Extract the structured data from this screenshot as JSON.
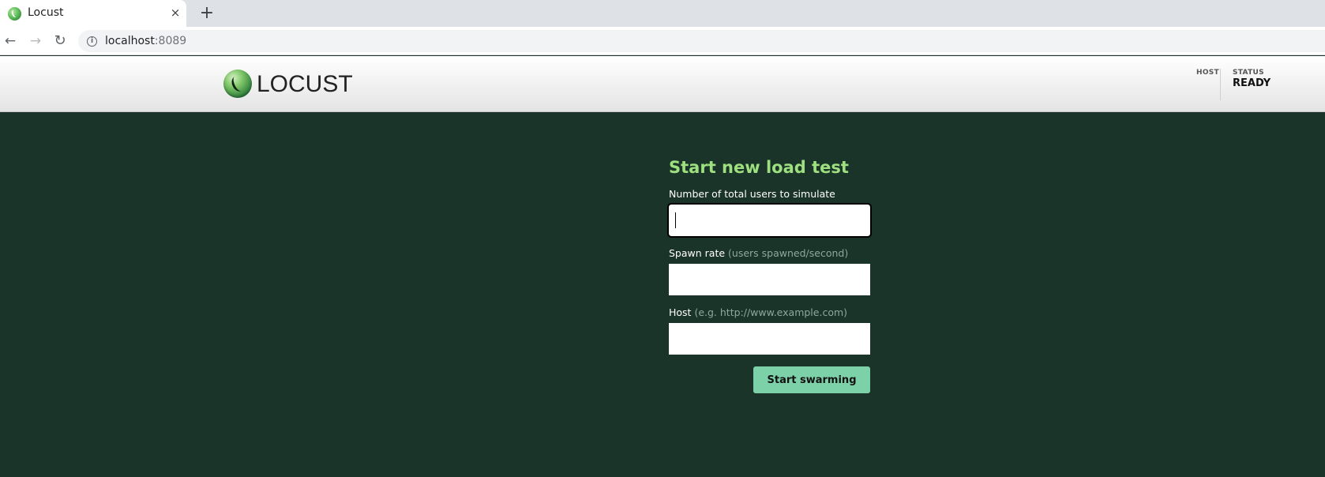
{
  "browser": {
    "tab_title": "Locust",
    "tab_close": "×",
    "new_tab": "+",
    "url_host": "localhost",
    "url_port": ":8089",
    "back_icon": "←",
    "forward_icon": "→",
    "reload_icon": "↻",
    "info_icon": "i"
  },
  "header": {
    "logo_text": "LOCUST",
    "host_label": "HOST",
    "host_value": "",
    "status_label": "STATUS",
    "status_value": "READY"
  },
  "form": {
    "title": "Start new load test",
    "users_label": "Number of total users to simulate",
    "users_value": "",
    "spawn_label": "Spawn rate",
    "spawn_hint": "(users spawned/second)",
    "spawn_value": "",
    "host_label": "Host",
    "host_hint": "(e.g. http://www.example.com)",
    "host_value": "",
    "submit_label": "Start swarming"
  },
  "colors": {
    "page_background": "#1b342a",
    "title_green": "#9ee07f",
    "button_green": "#7dd1a8"
  }
}
